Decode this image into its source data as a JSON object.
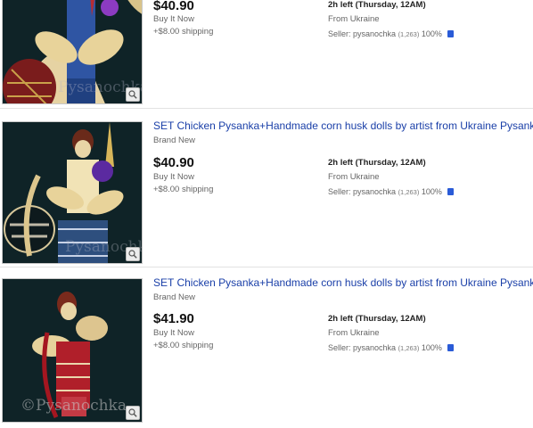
{
  "listings": [
    {
      "title": "",
      "condition": "",
      "price": "$40.90",
      "format": "Buy It Now",
      "shipping": "+$8.00 shipping",
      "time_left": "2h left (Thursday, 12AM)",
      "location": "From Ukraine",
      "seller_label": "Seller: pysanochka",
      "seller_feedback": "(1,263)",
      "seller_percent": "100%",
      "watermark": "Pysanochka",
      "icons": [
        "zoom-icon",
        "seller-badge-icon"
      ]
    },
    {
      "title": "SET Chicken Pysanka+Handmade corn husk dolls by artist from Ukraine Pysanky",
      "condition": "Brand New",
      "price": "$40.90",
      "format": "Buy It Now",
      "shipping": "+$8.00 shipping",
      "time_left": "2h left (Thursday, 12AM)",
      "location": "From Ukraine",
      "seller_label": "Seller: pysanochka",
      "seller_feedback": "(1,263)",
      "seller_percent": "100%",
      "watermark": "Pysanochka",
      "icons": [
        "zoom-icon",
        "seller-badge-icon"
      ]
    },
    {
      "title": "SET Chicken Pysanka+Handmade corn husk dolls by artist from Ukraine Pysanky",
      "condition": "Brand New",
      "price": "$41.90",
      "format": "Buy It Now",
      "shipping": "+$8.00 shipping",
      "time_left": "2h left (Thursday, 12AM)",
      "location": "From Ukraine",
      "seller_label": "Seller: pysanochka",
      "seller_feedback": "(1,263)",
      "seller_percent": "100%",
      "watermark": "©Pysanochka",
      "icons": [
        "zoom-icon",
        "seller-badge-icon"
      ]
    }
  ],
  "colors": {
    "title_link": "#1a3fa8",
    "price": "#111111",
    "thumb_background": "#0f2327",
    "seller_badge": "#2a5bd7"
  }
}
